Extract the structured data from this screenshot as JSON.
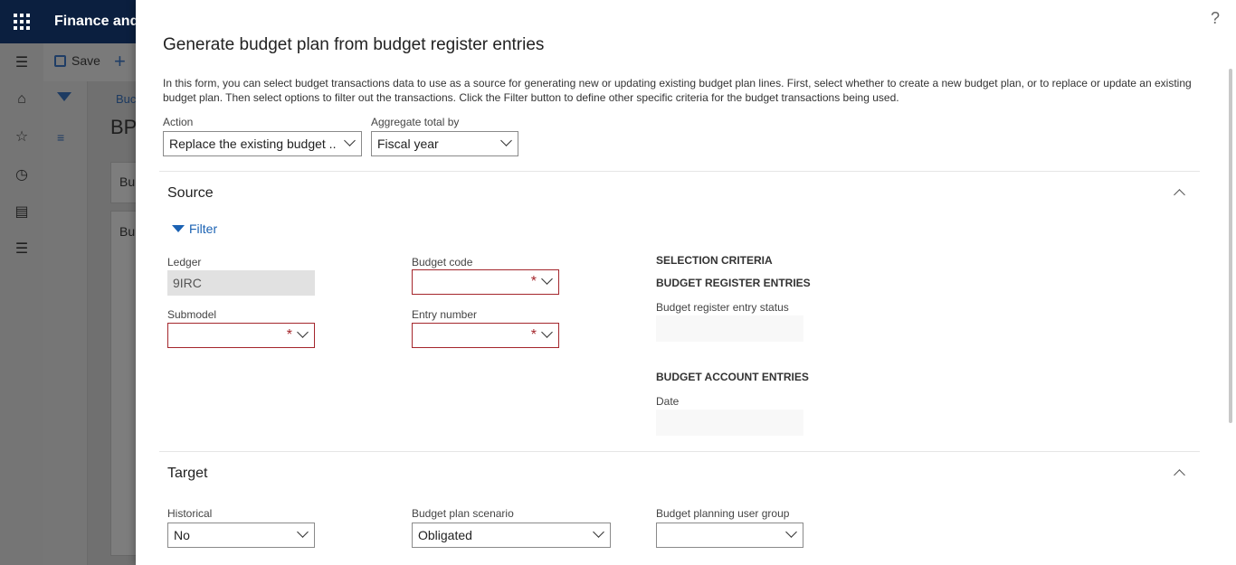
{
  "app": {
    "title": "Finance and"
  },
  "background": {
    "save_label": "Save",
    "breadcrumb_partial": "Buc",
    "page_title_partial": "BP",
    "card1_partial": "Bu",
    "card2_partial": "Bu"
  },
  "dialog": {
    "title": "Generate budget plan from budget register entries",
    "description": "In this form, you can select budget transactions data to use as a source for generating new or updating existing budget plan lines. First, select whether to create a new budget plan, or to replace or update an existing budget plan. Then select options to filter out the transactions. Click the Filter button to define other specific criteria for the budget transactions being used.",
    "help_label": "?",
    "action": {
      "label": "Action",
      "value": "Replace the existing budget ..."
    },
    "aggregate": {
      "label": "Aggregate total by",
      "value": "Fiscal year"
    },
    "source": {
      "title": "Source",
      "filter_label": "Filter",
      "ledger": {
        "label": "Ledger",
        "value": "9IRC"
      },
      "submodel": {
        "label": "Submodel",
        "value": ""
      },
      "budget_code": {
        "label": "Budget code",
        "value": ""
      },
      "entry_number": {
        "label": "Entry number",
        "value": ""
      },
      "selection_criteria": "SELECTION CRITERIA",
      "register_entries_heading": "BUDGET REGISTER ENTRIES",
      "register_status_label": "Budget register entry status",
      "account_entries_heading": "BUDGET ACCOUNT ENTRIES",
      "date_label": "Date",
      "required_mark": "*"
    },
    "target": {
      "title": "Target",
      "historical": {
        "label": "Historical",
        "value": "No"
      },
      "scenario": {
        "label": "Budget plan scenario",
        "value": "Obligated"
      },
      "user_group": {
        "label": "Budget planning user group",
        "value": ""
      }
    }
  },
  "colors": {
    "topbar": "#0b1f3f",
    "required_border": "#a4262c",
    "link": "#1b62b3"
  }
}
